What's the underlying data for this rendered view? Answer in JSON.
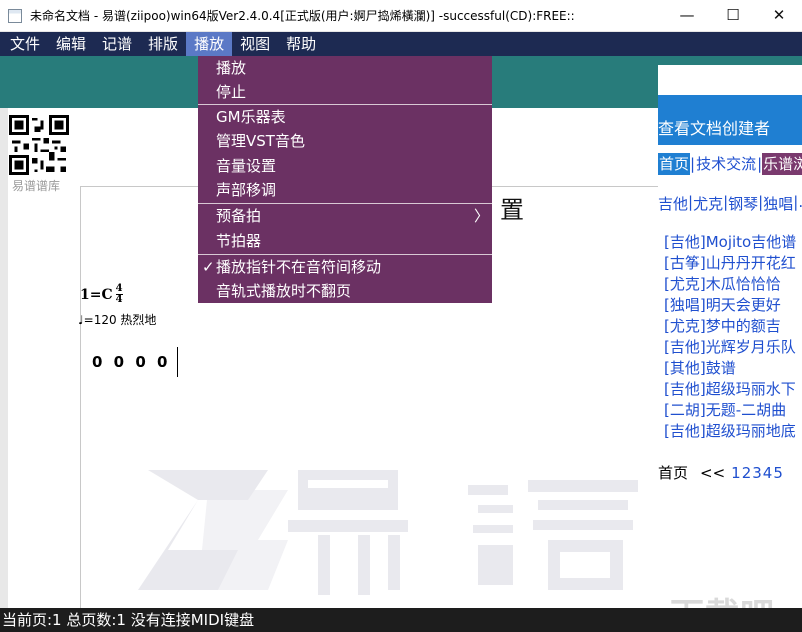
{
  "window": {
    "title": "未命名文档 - 易谱(ziipoo)win64版Ver2.4.0.4[正式版(用户:婀尸捣烯橫瀾)] -successful(CD):FREE::",
    "minimize": "—",
    "maximize": "☐",
    "close": "✕"
  },
  "menubar": {
    "items": [
      {
        "label": "文件"
      },
      {
        "label": "编辑"
      },
      {
        "label": "记谱"
      },
      {
        "label": "排版"
      },
      {
        "label": "播放"
      },
      {
        "label": "视图"
      },
      {
        "label": "帮助"
      }
    ]
  },
  "dropdown": {
    "items": [
      {
        "label": "播放"
      },
      {
        "label": "停止"
      },
      {
        "label": "GM乐器表"
      },
      {
        "label": "管理VST音色"
      },
      {
        "label": "音量设置"
      },
      {
        "label": "声部移调"
      },
      {
        "label": "预备拍",
        "submenu_arrow": "〉"
      },
      {
        "label": "节拍器"
      },
      {
        "label": "播放指针不在音符间移动",
        "check": "✓"
      },
      {
        "label": "音轨式播放时不翻页"
      }
    ]
  },
  "document": {
    "logo_label": "易谱谱库",
    "title_partial": "置",
    "key": "1=C",
    "time_sig_top": "4",
    "time_sig_bottom": "4",
    "tempo": "♩=120  热烈地",
    "notes": "0 0 0 0"
  },
  "right_panel": {
    "creator_link": "查看文档创建者",
    "tabs": [
      "首页",
      "技术交流",
      "乐谱浏"
    ],
    "categories": [
      "吉他",
      "尤克",
      "钢琴",
      "独唱",
      "..."
    ],
    "songs": [
      "[吉他]Mojito吉他谱",
      "[古筝]山丹丹开花红",
      "[尤克]木瓜恰恰恰",
      "[独唱]明天会更好",
      "[尤克]梦中的额吉",
      "[吉他]光辉岁月乐队",
      "[其他]鼓谱",
      "[吉他]超级玛丽水下",
      "[二胡]无题-二胡曲",
      "[吉他]超级玛丽地底"
    ],
    "pager": {
      "first": "首页",
      "prev": "<<",
      "pages": [
        "1",
        "2",
        "3",
        "4",
        "5"
      ]
    }
  },
  "watermark": {
    "site": "下载吧"
  },
  "statusbar": {
    "text": "当前页:1 总页数:1 没有连接MIDI键盘"
  },
  "colors": {
    "menubar_bg": "#1d2a52",
    "menu_active": "#5b79c6",
    "dropdown_bg": "#6b3163",
    "teal_band": "#287c7b",
    "link_blue": "#1f4fcf",
    "panel_blue": "#1f7fd2",
    "statusbar_bg": "#1d1d1d"
  }
}
